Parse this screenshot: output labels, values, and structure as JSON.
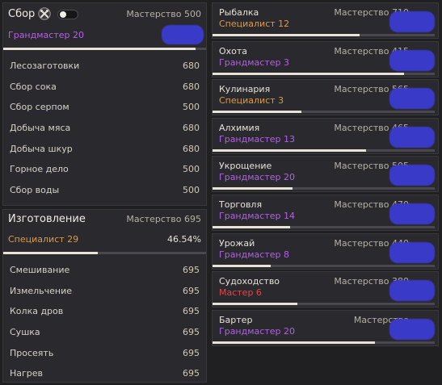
{
  "colors": {
    "background": "#202023",
    "panel": "#2a2a2e",
    "rank_purple": "#b55ee8",
    "rank_orange": "#dc9a4a",
    "rank_red": "#e04747",
    "bar_fill": "#e8e3d8",
    "bar_track": "#48484e",
    "redaction_blue": "#3a3ac9"
  },
  "gathering": {
    "title": "Сбор",
    "icon": "crossed-tools-icon",
    "toggle_on": true,
    "mastery_label": "Мастерство 500",
    "rank": "Грандмастер 20",
    "progress": 0.95,
    "skills": [
      {
        "name": "Лесозаготовки",
        "value": "680"
      },
      {
        "name": "Сбор сока",
        "value": "680"
      },
      {
        "name": "Сбор серпом",
        "value": "500"
      },
      {
        "name": "Добыча мяса",
        "value": "680"
      },
      {
        "name": "Добыча шкур",
        "value": "680"
      },
      {
        "name": "Горное дело",
        "value": "500"
      },
      {
        "name": "Сбор воды",
        "value": "500"
      }
    ]
  },
  "crafting": {
    "title": "Изготовление",
    "mastery_label": "Мастерство 695",
    "rank": "Специалист 29",
    "percent": "46.54%",
    "progress": 0.4654,
    "skills": [
      {
        "name": "Смешивание",
        "value": "695"
      },
      {
        "name": "Измельчение",
        "value": "695"
      },
      {
        "name": "Колка дров",
        "value": "695"
      },
      {
        "name": "Сушка",
        "value": "695"
      },
      {
        "name": "Просеять",
        "value": "695"
      },
      {
        "name": "Нагрев",
        "value": "695"
      }
    ]
  },
  "life_skills": [
    {
      "name": "Рыбалка",
      "rank": "Специалист 12",
      "rank_color": "orange",
      "mastery": "Мастерство 710",
      "progress": 0.66
    },
    {
      "name": "Охота",
      "rank": "Грандмастер 3",
      "rank_color": "purple",
      "mastery": "Мастерство 415",
      "progress": 0.86
    },
    {
      "name": "Кулинария",
      "rank": "Специалист 3",
      "rank_color": "orange",
      "mastery": "Мастерство 565",
      "progress": 0.4
    },
    {
      "name": "Алхимия",
      "rank": "Грандмастер 13",
      "rank_color": "purple",
      "mastery": "Мастерство 465",
      "progress": 0.69
    },
    {
      "name": "Укрощение",
      "rank": "Грандмастер 20",
      "rank_color": "purple",
      "mastery": "Мастерство 505",
      "progress": 0.36
    },
    {
      "name": "Торговля",
      "rank": "Грандмастер 14",
      "rank_color": "purple",
      "mastery": "Мастерство 470",
      "progress": 0.35
    },
    {
      "name": "Урожай",
      "rank": "Грандмастер 8",
      "rank_color": "purple",
      "mastery": "Мастерство 440",
      "progress": 0.26
    },
    {
      "name": "Судоходство",
      "rank": "Мастер 6",
      "rank_color": "red",
      "mastery": "Мастерство 380",
      "progress": 0.38
    },
    {
      "name": "Бартер",
      "rank": "Грандмастер 20",
      "rank_color": "purple",
      "mastery": "Мастерство",
      "progress": 0.73
    }
  ]
}
